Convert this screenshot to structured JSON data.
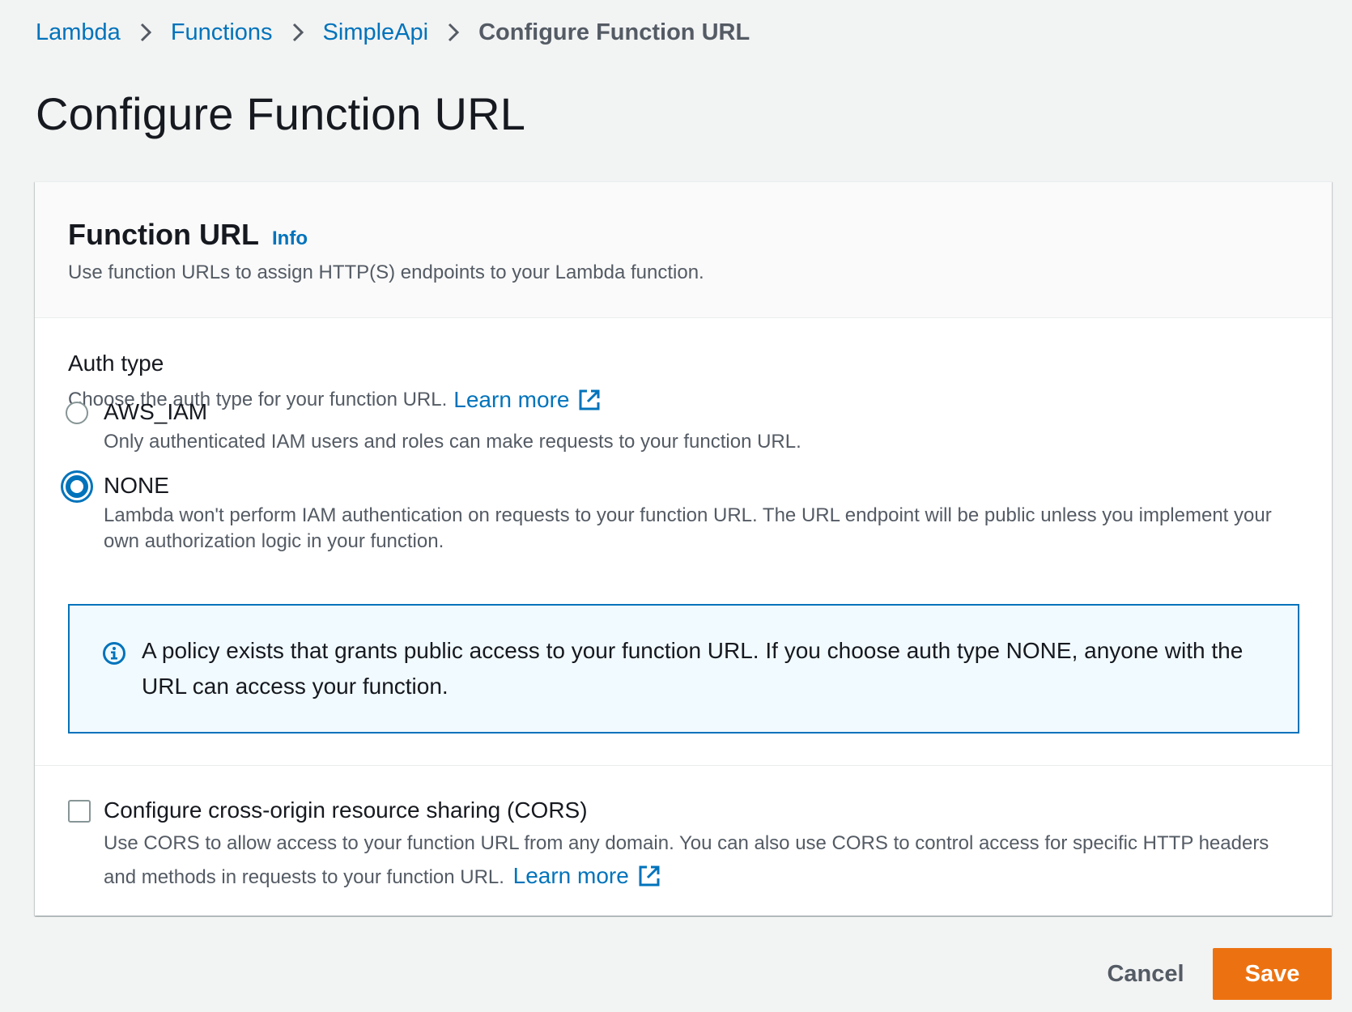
{
  "breadcrumb": {
    "items": [
      "Lambda",
      "Functions",
      "SimpleApi"
    ],
    "current": "Configure Function URL"
  },
  "page": {
    "title": "Configure Function URL"
  },
  "function_url": {
    "title": "Function URL",
    "info": "Info",
    "description": "Use function URLs to assign HTTP(S) endpoints to your Lambda function."
  },
  "auth": {
    "label": "Auth type",
    "description": "Choose the auth type for your function URL.",
    "learn_more": "Learn more",
    "selected": "NONE",
    "options": [
      {
        "label": "AWS_IAM",
        "description": "Only authenticated IAM users and roles can make requests to your function URL."
      },
      {
        "label": "NONE",
        "description": "Lambda won't perform IAM authentication on requests to your function URL. The URL endpoint will be public unless you implement your own authorization logic in your function."
      }
    ]
  },
  "alert": {
    "icon": "info-circle-icon",
    "text": "A policy exists that grants public access to your function URL. If you choose auth type NONE, anyone with the URL can access your function."
  },
  "cors": {
    "checked": false,
    "label": "Configure cross-origin resource sharing (CORS)",
    "description": "Use CORS to allow access to your function URL from any domain. You can also use CORS to control access for specific HTTP headers and methods in requests to your function URL.",
    "learn_more": "Learn more"
  },
  "footer": {
    "cancel": "Cancel",
    "save": "Save"
  },
  "colors": {
    "link": "#0073bb",
    "primary_button": "#ec7211",
    "alert_bg": "#f1faff",
    "background": "#f2f3f3"
  }
}
